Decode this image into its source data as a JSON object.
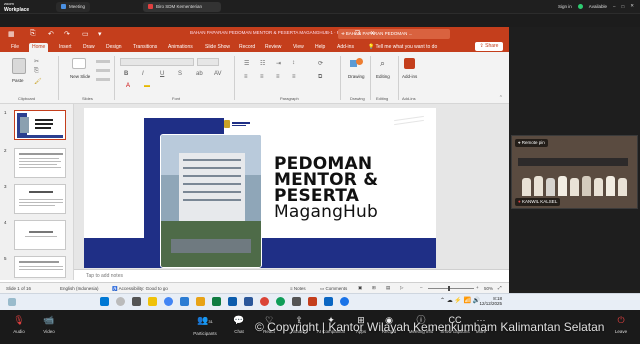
{
  "zoom": {
    "logo_line1": "zoom",
    "logo_line2": "Workplace",
    "tabs": [
      {
        "label": "Meeting"
      },
      {
        "label": "Biro SDM Kementerian Hukum's ..."
      }
    ],
    "signin": "Sign in",
    "status": "Available",
    "bottom": [
      {
        "label": "Audio"
      },
      {
        "label": "Video"
      },
      {
        "label": "Participants",
        "count": "31"
      },
      {
        "label": "Chat"
      },
      {
        "label": "React"
      },
      {
        "label": "Share"
      },
      {
        "label": "AI Companion"
      },
      {
        "label": "Apps"
      },
      {
        "label": "Record"
      },
      {
        "label": "Meeting info"
      },
      {
        "label": "Show captions"
      },
      {
        "label": "More"
      },
      {
        "label": "Leave"
      }
    ],
    "copyright": "© Copyright | Kantor Wilayah Kemenkumham Kalimantan Selatan"
  },
  "ppt": {
    "doc_title": "BAHAN PAPARAN PEDOMAN MENTOR & PESERTA MAGANGHUB-1 · PowerPoint",
    "search_placeholder": "BAHAN PAPARAN PEDOMAN ...",
    "tell_me": "Tell me what you want to do",
    "share": "Share",
    "tabs": [
      "File",
      "Home",
      "Insert",
      "Draw",
      "Design",
      "Transitions",
      "Animations",
      "Slide Show",
      "Record",
      "Review",
      "View",
      "Help",
      "Add-ins"
    ],
    "active_tab": "Home",
    "groups": {
      "clipboard": "Clipboard",
      "slides": "Slides",
      "font": "Font",
      "paragraph": "Paragraph",
      "drawing": "Drawing",
      "editing": "Editing",
      "addins": "Add-ins"
    },
    "buttons": {
      "paste": "Paste",
      "new_slide": "New Slide",
      "drawing": "Drawing",
      "editing": "Editing",
      "addins": "Add-ins"
    },
    "thumb_numbers": [
      "1",
      "2",
      "3",
      "4",
      "5"
    ],
    "slide_title_lines": [
      "PEDOMAN",
      "MENTOR &",
      "PESERTA",
      "MagangHub"
    ],
    "notes_placeholder": "Tap to add notes",
    "status": {
      "slide_count": "Slide 1 of 16",
      "language": "English (Indonesia)",
      "accessibility": "Accessibility: Good to go",
      "notes": "Notes",
      "comments": "Comments",
      "zoom": "50%"
    }
  },
  "video": {
    "badge": "Remote pin",
    "participant_name": "KANWIL KALSEL"
  },
  "taskbar": {
    "time": "8:18",
    "date": "12/12/2025"
  }
}
